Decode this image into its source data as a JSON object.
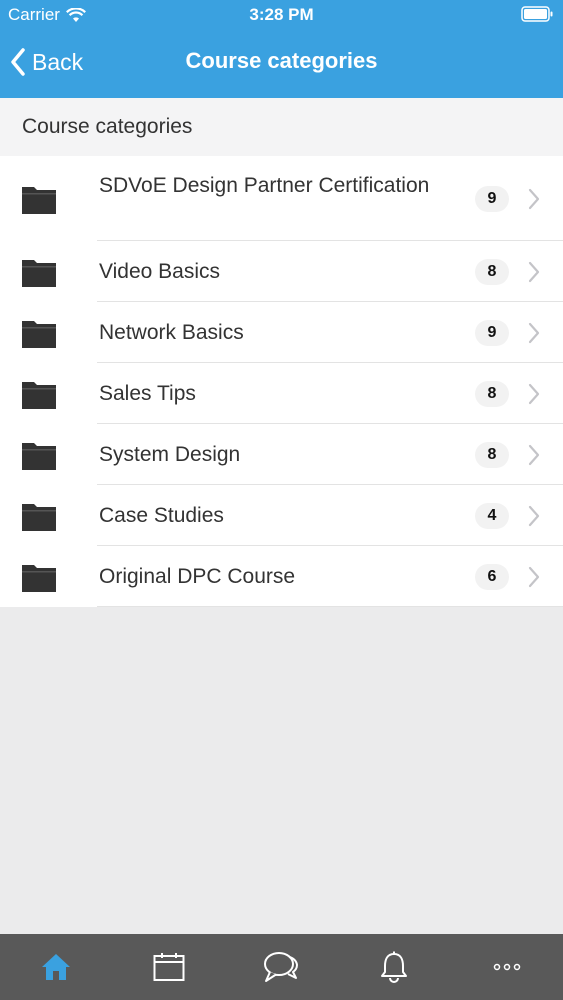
{
  "status_bar": {
    "carrier": "Carrier",
    "time": "3:28 PM"
  },
  "nav": {
    "back_label": "Back",
    "title": "Course categories"
  },
  "section": {
    "header": "Course categories"
  },
  "categories": [
    {
      "label": "SDVoE Design Partner Certification",
      "count": "9"
    },
    {
      "label": "Video Basics",
      "count": "8"
    },
    {
      "label": "Network Basics",
      "count": "9"
    },
    {
      "label": "Sales Tips",
      "count": "8"
    },
    {
      "label": "System Design",
      "count": "8"
    },
    {
      "label": "Case Studies",
      "count": "4"
    },
    {
      "label": "Original DPC Course",
      "count": "6"
    }
  ],
  "tab_bar": {
    "tabs": [
      {
        "icon": "home-icon",
        "active": true
      },
      {
        "icon": "calendar-icon",
        "active": false
      },
      {
        "icon": "chat-icon",
        "active": false
      },
      {
        "icon": "bell-icon",
        "active": false
      },
      {
        "icon": "more-icon",
        "active": false
      }
    ]
  },
  "colors": {
    "accent": "#3aa1e0",
    "tab_bar": "#595959",
    "background": "#ebebec"
  }
}
